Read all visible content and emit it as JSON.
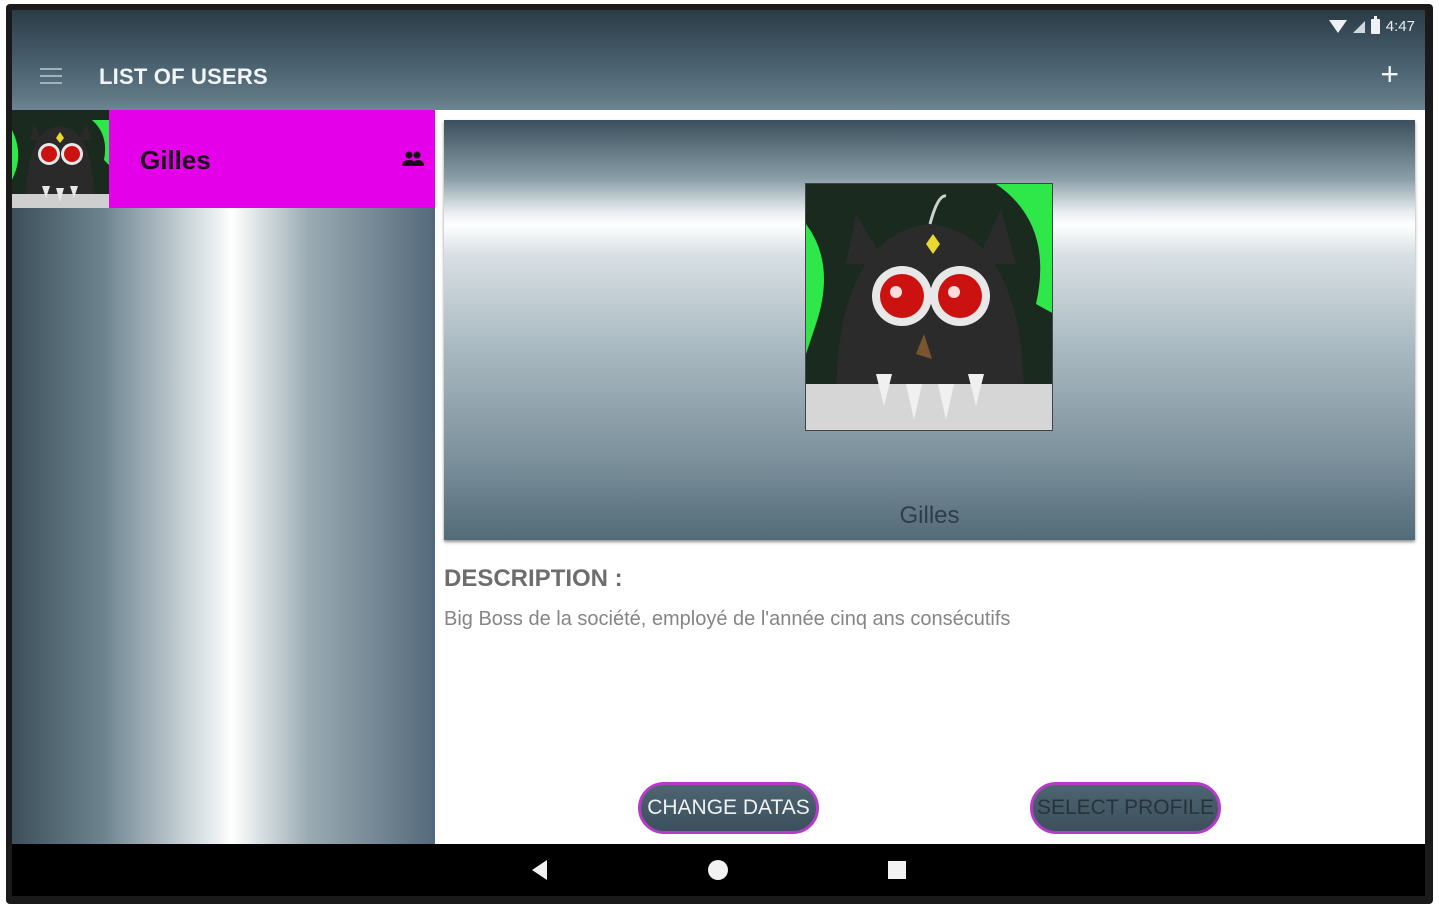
{
  "status_bar": {
    "time": "4:47"
  },
  "toolbar": {
    "title": "LIST OF USERS",
    "add_label": "+"
  },
  "users": [
    {
      "name": "Gilles",
      "highlight_color": "#e400e8"
    }
  ],
  "profile": {
    "name": "Gilles",
    "description_title": "DESCRIPTION :",
    "description": "Big Boss de la société, employé de l'année cinq ans consécutifs"
  },
  "buttons": {
    "change_label": "CHANGE DATAS",
    "select_label": "SELECT PROFILE"
  },
  "colors": {
    "accent": "#b53bc9",
    "toolbar": "#4d6573",
    "selected_row": "#e400e8"
  },
  "icons": [
    "wifi-icon",
    "signal-icon",
    "battery-icon",
    "menu-icon",
    "add-icon",
    "group-icon",
    "back-icon",
    "home-icon",
    "recents-icon"
  ]
}
